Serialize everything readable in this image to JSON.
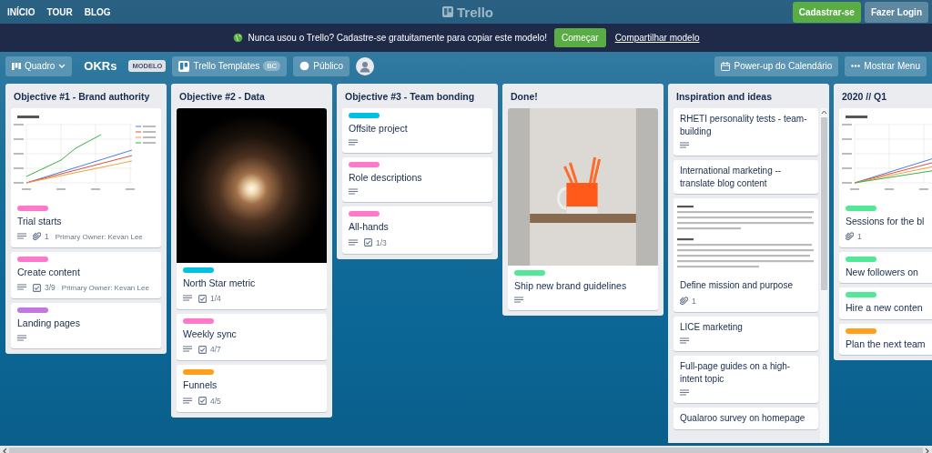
{
  "nav": {
    "links": [
      "INÍCIO",
      "TOUR",
      "BLOG"
    ],
    "logo": "Trello",
    "buttons": [
      {
        "label": "Cadastrar-se",
        "kind": "primary"
      },
      {
        "label": "Fazer Login",
        "kind": "secondary"
      }
    ]
  },
  "banner": {
    "text": "Nunca usou o Trello? Cadastre-se gratuitamente para copiar este modelo!",
    "button": "Começar",
    "link": "Compartilhar modelo"
  },
  "board_header": {
    "view_button": "Quadro",
    "title": "OKRs",
    "badge": "MODELO",
    "team_button": {
      "label": "Trello Templates",
      "badge": "BC"
    },
    "visibility_button": "Público",
    "actions": [
      {
        "kind": "calendar",
        "label": "Power-up do Calendário"
      },
      {
        "kind": "menu",
        "label": "Mostrar Menu"
      }
    ]
  },
  "lists": [
    {
      "kind": "plain",
      "title": "Objective #1 - Brand authority",
      "cards": [
        {
          "cover": {
            "kind": "chart",
            "legend": true
          },
          "color": "#ff78cb",
          "title": "Trial starts",
          "badges": [
            {
              "kind": "description"
            },
            {
              "kind": "attachment",
              "text": "1"
            },
            {
              "kind": "owner",
              "text": "Primary Owner: Kevan Lee"
            }
          ]
        },
        {
          "color": "#ff78cb",
          "title": "Create content",
          "badges": [
            {
              "kind": "description"
            },
            {
              "kind": "checklist",
              "text": "3/9"
            },
            {
              "kind": "owner",
              "text": "Primary Owner: Kevan Lee"
            }
          ]
        },
        {
          "color": "#c377e0",
          "title": "Landing pages",
          "badges": [
            {
              "kind": "description"
            }
          ]
        }
      ]
    },
    {
      "kind": "plain",
      "title": "Objective #2 - Data",
      "cards": [
        {
          "cover": {
            "kind": "starfield"
          },
          "color": "#00c2e0",
          "title": "North Star metric",
          "badges": [
            {
              "kind": "description"
            },
            {
              "kind": "checklist",
              "text": "1/4"
            }
          ]
        },
        {
          "color": "#ff78cb",
          "title": "Weekly sync",
          "badges": [
            {
              "kind": "description"
            },
            {
              "kind": "checklist",
              "text": "4/7"
            }
          ]
        },
        {
          "color": "#ff9f1a",
          "title": "Funnels",
          "badges": [
            {
              "kind": "description"
            },
            {
              "kind": "checklist",
              "text": "4/5"
            }
          ]
        }
      ]
    },
    {
      "kind": "plain",
      "title": "Objective #3 - Team bonding",
      "cards": [
        {
          "color": "#00c2e0",
          "title": "Offsite project",
          "badges": [
            {
              "kind": "description"
            }
          ]
        },
        {
          "color": "#ff78cb",
          "title": "Role descriptions",
          "badges": [
            {
              "kind": "description"
            }
          ]
        },
        {
          "color": "#ff78cb",
          "title": "All-hands",
          "badges": [
            {
              "kind": "description"
            },
            {
              "kind": "checklist",
              "text": "1/3"
            }
          ]
        }
      ]
    },
    {
      "kind": "plain",
      "title": "Done!",
      "cards": [
        {
          "cover": {
            "kind": "mug"
          },
          "color": "#51e898",
          "title": "Ship new brand guidelines",
          "badges": [
            {
              "kind": "description"
            }
          ]
        }
      ]
    },
    {
      "kind": "scrolling",
      "title": "Inspiration and ideas",
      "cards": [
        {
          "title": "RHETI personality tests - team-building",
          "badges": [
            {
              "kind": "description"
            }
          ]
        },
        {
          "title": "International marketing -- translate blog content"
        },
        {
          "cover": {
            "kind": "document"
          },
          "title": "Define mission and purpose",
          "badges": [
            {
              "kind": "attachment",
              "text": "1"
            }
          ]
        },
        {
          "title": "LICE marketing",
          "badges": [
            {
              "kind": "description"
            }
          ]
        },
        {
          "title": "Full-page guides on a high-intent topic",
          "badges": [
            {
              "kind": "description"
            }
          ]
        },
        {
          "title": "Qualaroo survey on homepage"
        }
      ]
    },
    {
      "kind": "plain",
      "title": "2020 // Q1",
      "cards": [
        {
          "cover": {
            "kind": "chart",
            "legend": false
          },
          "color": "#51e898",
          "title": "Sessions for the bl",
          "badges": [
            {
              "kind": "attachment",
              "text": "1"
            }
          ]
        },
        {
          "color": "#51e898",
          "title": "New followers on"
        },
        {
          "color": "#51e898",
          "title": "Hire a new conten"
        },
        {
          "color": "#ff9f1a",
          "title": "Plan the next team"
        }
      ]
    }
  ]
}
